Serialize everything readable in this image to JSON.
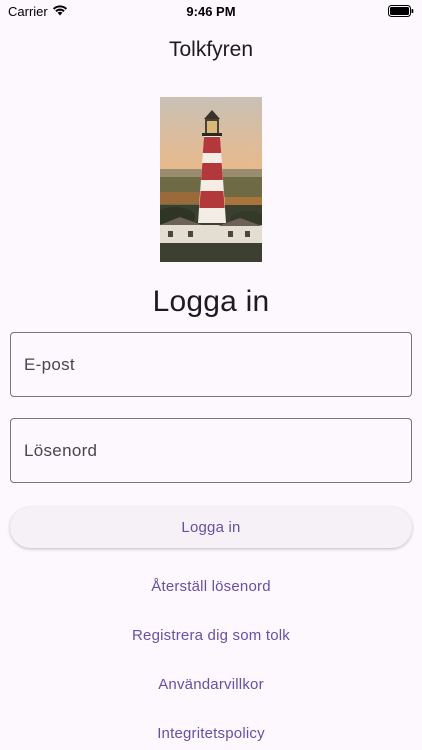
{
  "status_bar": {
    "carrier": "Carrier",
    "time": "9:46 PM",
    "icons": [
      "wifi-icon",
      "battery-icon"
    ]
  },
  "app": {
    "title": "Tolkfyren"
  },
  "login": {
    "heading": "Logga in",
    "email_label": "E-post",
    "password_label": "Lösenord",
    "submit_label": "Logga in"
  },
  "links": {
    "reset_password": "Återställ lösenord",
    "register": "Registrera dig som tolk",
    "terms": "Användarvillkor",
    "privacy": "Integritetspolicy"
  },
  "colors": {
    "background": "#fdf8fd",
    "accent": "#6750a4",
    "outline": "#79747e",
    "button_bg": "#f6f1f7"
  }
}
